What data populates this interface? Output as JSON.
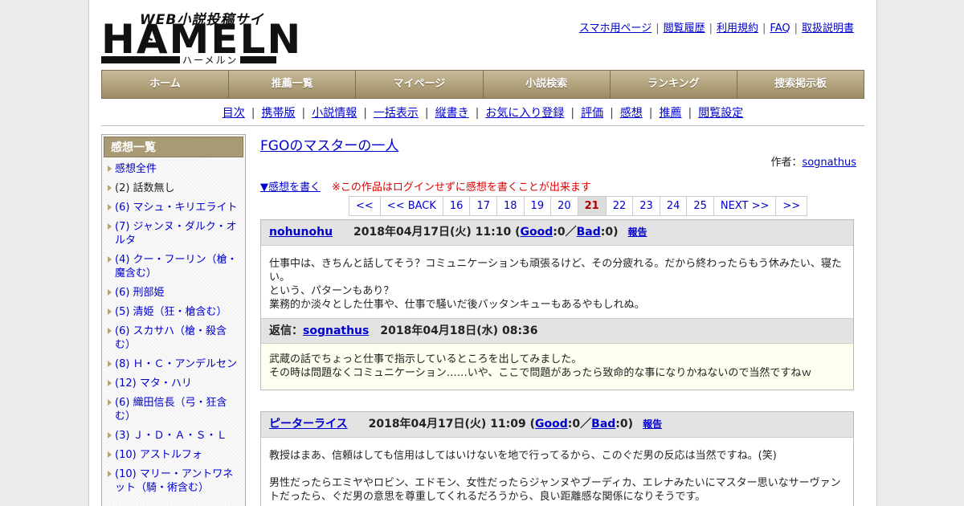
{
  "header": {
    "logo_tagline": "WEB小説投稿サイト",
    "logo_text": "HAMELN",
    "logo_kana": "ハーメルン",
    "links": [
      "スマホ用ページ",
      "閲覧履歴",
      "利用規約",
      "FAQ",
      "取扱説明書"
    ]
  },
  "nav": [
    "ホーム",
    "推薦一覧",
    "マイページ",
    "小説検索",
    "ランキング",
    "捜索掲示板"
  ],
  "subnav": [
    "目次",
    "携帯版",
    "小説情報",
    "一括表示",
    "縦書き",
    "お気に入り登録",
    "評価",
    "感想",
    "推薦",
    "閲覧設定"
  ],
  "sidebar": {
    "title": "感想一覧",
    "items": [
      "感想全件",
      "(2) 話数無し",
      "(6) マシュ・キリエライト",
      "(7) ジャンヌ・ダルク・オルタ",
      "(4) クー・フーリン（槍・魔含む）",
      "(6) 刑部姫",
      "(5) 清姫（狂・槍含む）",
      "(6) スカサハ（槍・殺含む）",
      "(8) Ｈ・Ｃ・アンデルセン",
      "(12) マタ・ハリ",
      "(6) 織田信長（弓・狂含む）",
      "(3) Ｊ・Ｄ・Ａ・Ｓ・Ｌ",
      "(10) アストルフォ",
      "(10) マリー・アントワネット（騎・術含む）"
    ]
  },
  "main": {
    "title": "FGOのマスターの一人",
    "author_label": "作者：",
    "author": "sognathus",
    "write_link": "▼感想を書く",
    "write_warning": "※この作品はログインせずに感想を書くことが出来ます",
    "pager": [
      "<<",
      "<< BACK",
      "16",
      "17",
      "18",
      "19",
      "20",
      "21",
      "22",
      "23",
      "24",
      "25",
      "NEXT >>",
      ">>"
    ],
    "pager_current": "21"
  },
  "comments": [
    {
      "user": "nohunohu",
      "date": "2018年04月17日(火) 11:10",
      "good_label": "Good",
      "good": "0",
      "bad_label": "Bad",
      "bad": "0",
      "report": "報告",
      "lines": [
        "仕事中は、きちんと話してそう？コミュニケーションも頑張るけど、その分疲れる。だから終わったらもう休みたい、寝たい。",
        "という、パターンもあり？",
        "業務的か淡々とした仕事や、仕事で騒いだ後バッタンキューもあるやもしれぬ。"
      ],
      "reply": {
        "label": "返信：",
        "user": "sognathus",
        "date": "2018年04月18日(水) 08:36",
        "lines": [
          "武蔵の話でちょっと仕事で指示しているところを出してみました。",
          "その時は問題なくコミュニケーション……いや、ここで問題があったら致命的な事になりかねないので当然ですねｗ"
        ]
      }
    },
    {
      "user": "ピーターライス",
      "date": "2018年04月17日(火) 11:09",
      "good_label": "Good",
      "good": "0",
      "bad_label": "Bad",
      "bad": "0",
      "report": "報告",
      "lines": [
        "教授はまあ、信頼はしても信用はしてはいけないを地で行ってるから、このぐだ男の反応は当然ですね。(笑)",
        "",
        "男性だったらエミヤやロビン、エドモン、女性だったらジャンヌやブーディカ、エレナみたいにマスター思いなサーヴァントだったら、ぐだ男の意思を尊重してくれるだろうから、良い距離感な関係になりそうです。"
      ]
    }
  ]
}
